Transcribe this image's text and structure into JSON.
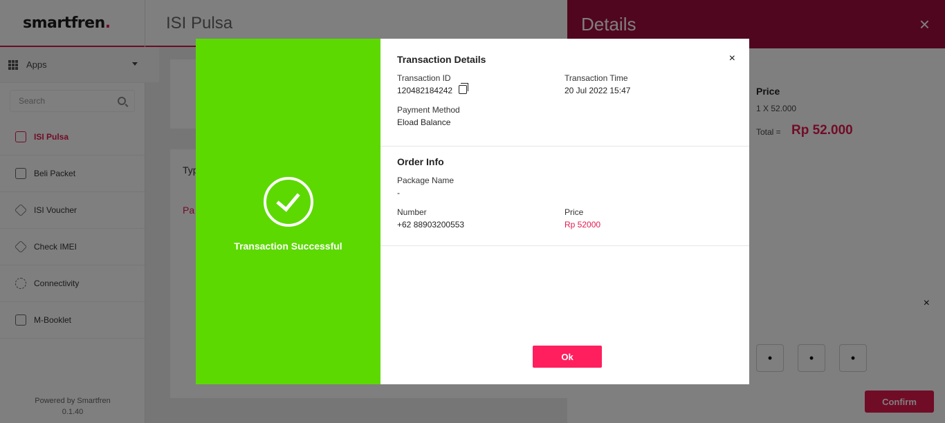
{
  "app": {
    "logo": "smartfren",
    "logo_dot": ".",
    "page_title": "ISI Pulsa",
    "apps_label": "Apps",
    "search_placeholder": "Search",
    "nav": [
      {
        "label": "ISI Pulsa",
        "icon": "phone-pulsa-icon",
        "active": true
      },
      {
        "label": "Beli Packet",
        "icon": "package-icon",
        "active": false
      },
      {
        "label": "ISI Voucher",
        "icon": "voucher-icon",
        "active": false
      },
      {
        "label": "Check IMEI",
        "icon": "tag-icon",
        "active": false
      },
      {
        "label": "Connectivity",
        "icon": "gear-icon",
        "active": false
      },
      {
        "label": "M-Booklet",
        "icon": "booklet-icon",
        "active": false
      }
    ],
    "powered_by": "Powered by Smartfren",
    "version": "0.1.40",
    "content_partial_1": "Typ",
    "content_partial_2": "Pa"
  },
  "details": {
    "title": "Details",
    "close": "×",
    "price_header": "Price",
    "price_qty": "1 X 52.000",
    "total_label": "Total =",
    "total_value": "Rp 52.000",
    "pin_close": "×",
    "pin_dots": [
      "•",
      "•",
      "•"
    ],
    "confirm_label": "Confirm"
  },
  "modal": {
    "status_text": "Transaction Successful",
    "close": "×",
    "transaction_details": {
      "title": "Transaction Details",
      "transaction_id_label": "Transaction ID",
      "transaction_id": "120482184242",
      "transaction_time_label": "Transaction Time",
      "transaction_time": "20 Jul 2022 15:47",
      "payment_method_label": "Payment Method",
      "payment_method": "Eload Balance"
    },
    "order_info": {
      "title": "Order Info",
      "package_name_label": "Package Name",
      "package_name": "-",
      "number_label": "Number",
      "number": "+62 88903200553",
      "price_label": "Price",
      "price": "Rp 52000"
    },
    "ok_label": "Ok"
  },
  "colors": {
    "brand": "#e2184f",
    "success": "#5cd900",
    "details_header": "#a00d3c"
  }
}
